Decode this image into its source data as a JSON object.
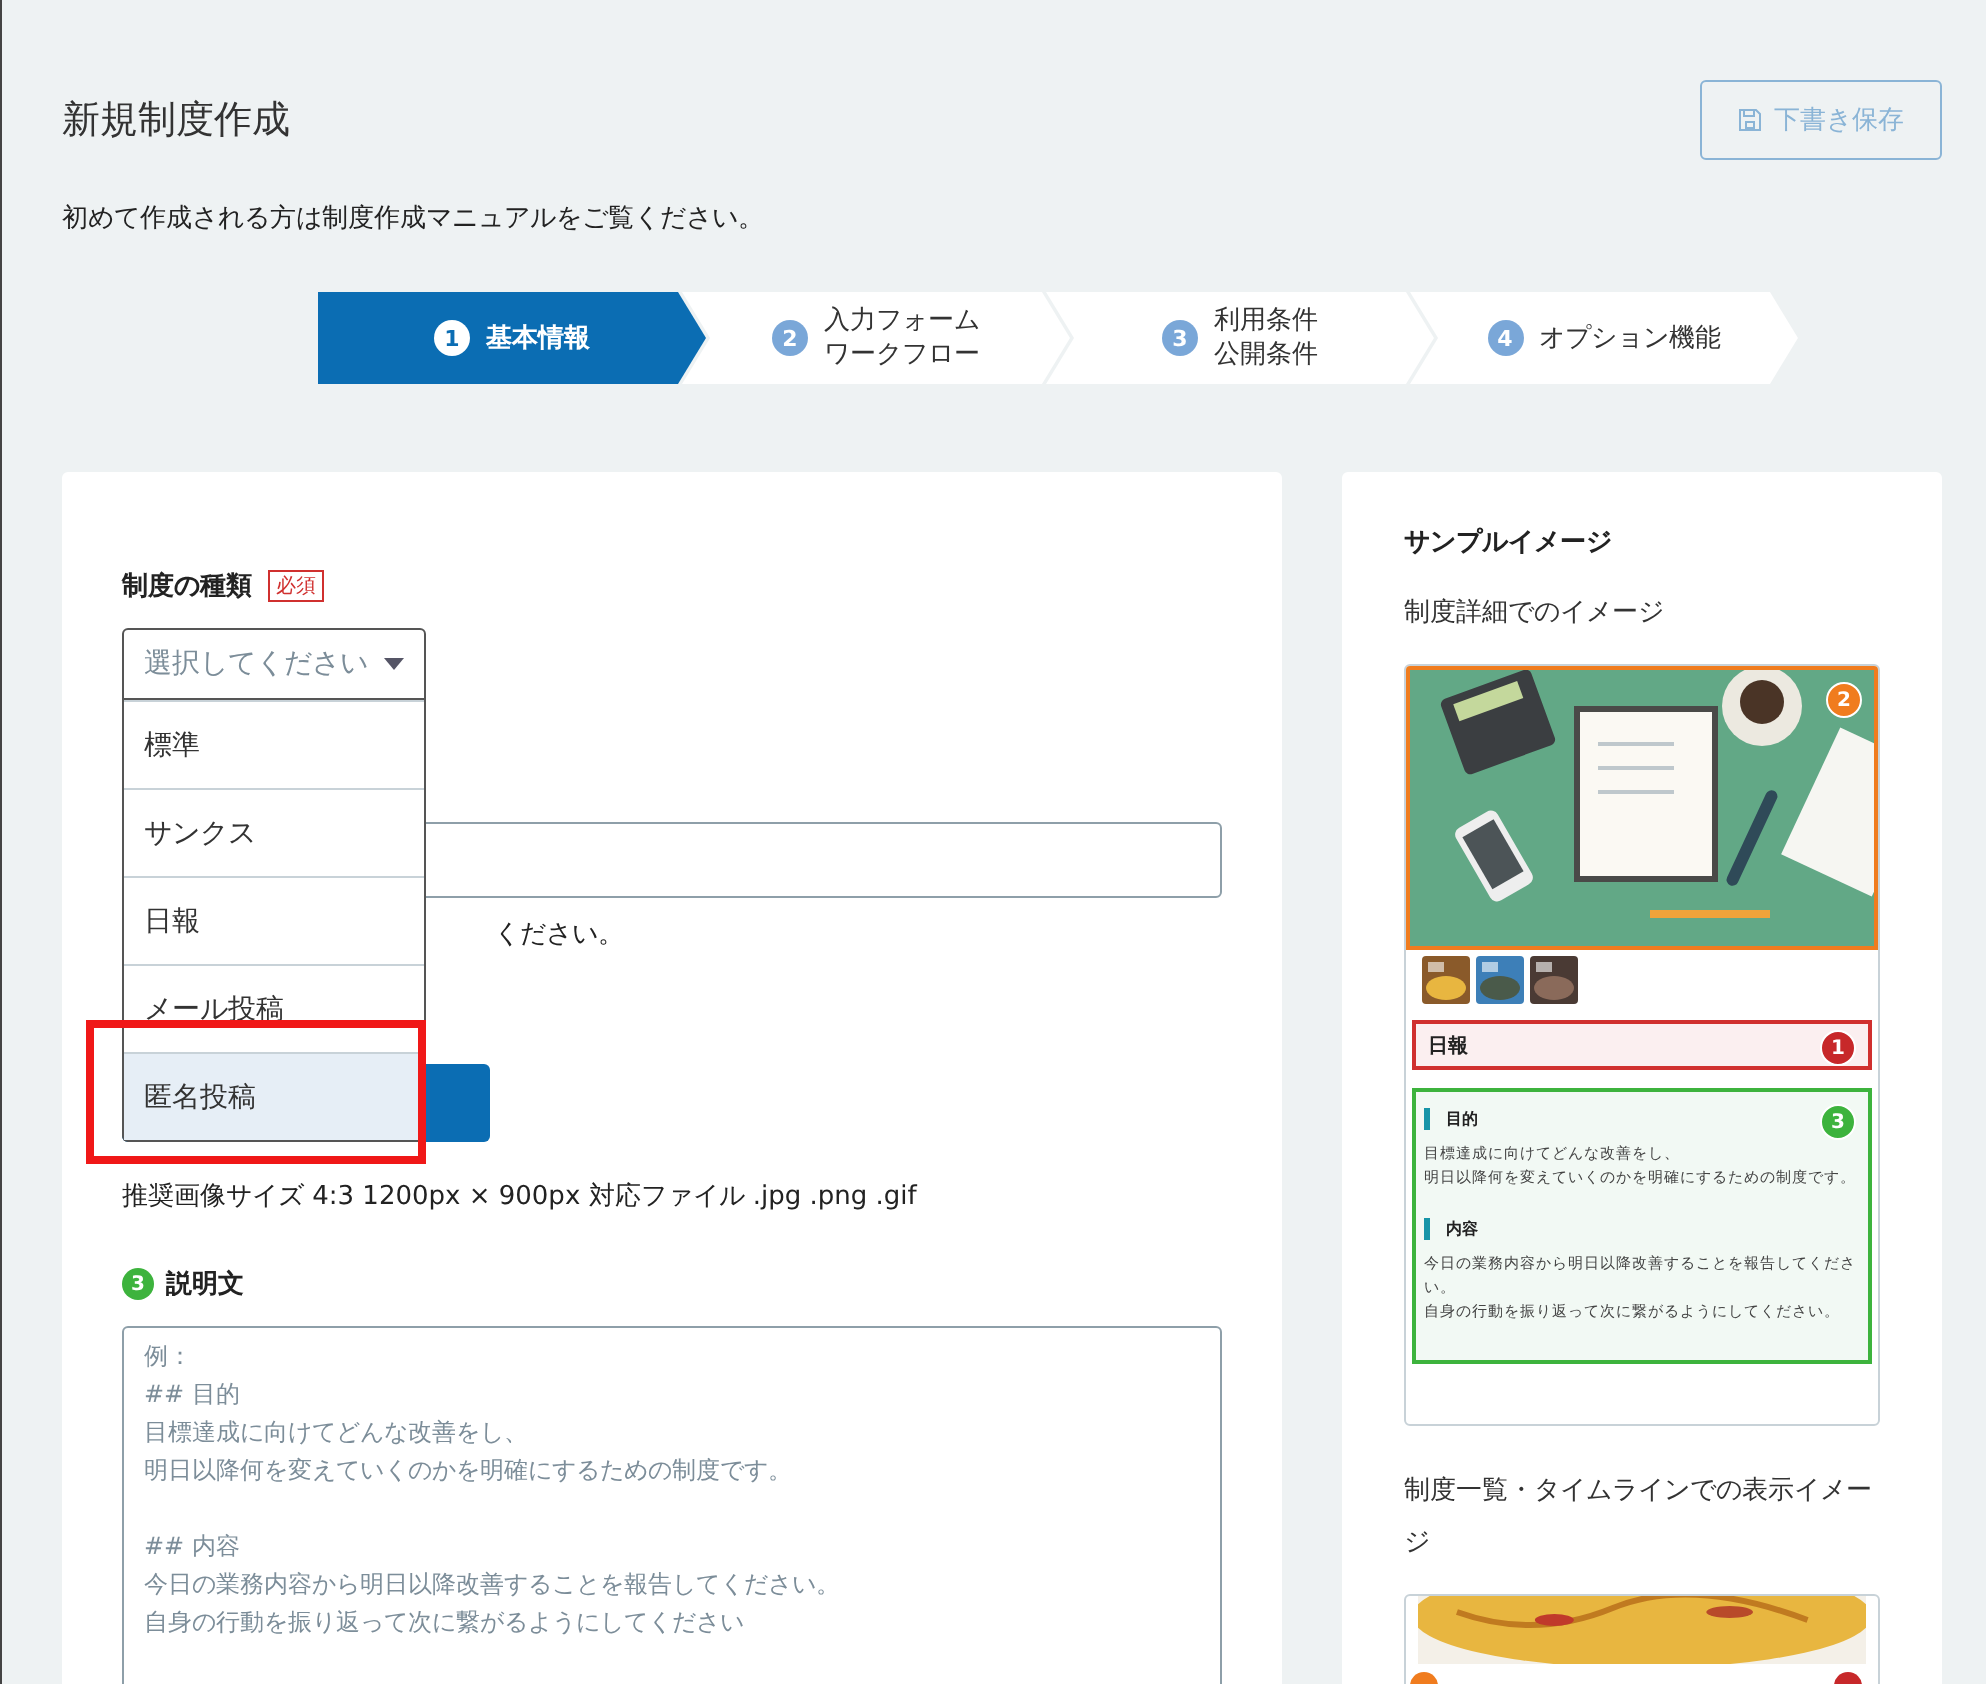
{
  "header": {
    "title": "新規制度作成",
    "save_button": "下書き保存",
    "intro": "初めて作成される方は制度作成マニュアルをご覧ください。"
  },
  "steps": [
    {
      "number": "1",
      "lines": [
        "基本情報"
      ],
      "selected": true
    },
    {
      "number": "2",
      "lines": [
        "入力フォーム",
        "ワークフロー"
      ],
      "selected": false
    },
    {
      "number": "3",
      "lines": [
        "利用条件",
        "公開条件"
      ],
      "selected": false
    },
    {
      "number": "4",
      "lines": [
        "オプション機能"
      ],
      "selected": false
    }
  ],
  "form": {
    "type_label": "制度の種類",
    "required_badge": "必須",
    "select": {
      "placeholder": "選択してください",
      "expanded": true,
      "options": [
        {
          "label": "標準",
          "selected": false
        },
        {
          "label": "サンクス",
          "selected": false
        },
        {
          "label": "日報",
          "selected": false
        },
        {
          "label": "メール投稿",
          "selected": false
        },
        {
          "label": "匿名投稿",
          "selected": true
        }
      ]
    },
    "name_hint": "ください。",
    "image_hint": "推奨画像サイズ 4:3 1200px × 900px 対応ファイル .jpg .png .gif",
    "description": {
      "number": "3",
      "label": "説明文",
      "placeholder_paragraphs": [
        [
          "例：",
          "## 目的",
          "目標達成に向けてどんな改善をし、",
          "明日以降何を変えていくのかを明確にするための制度です。"
        ],
        [
          "## 内容",
          "今日の業務内容から明日以降改善することを報告してください。",
          "自身の行動を振り返って次に繋がるようにしてください"
        ]
      ]
    }
  },
  "sample": {
    "title": "サンプルイメージ",
    "detail_heading": "制度詳細でのイメージ",
    "detail": {
      "image_badge": "2",
      "name": "日報",
      "name_badge": "1",
      "body_badge": "3",
      "sections": [
        {
          "heading": "目的",
          "lines": [
            "目標達成に向けてどんな改善をし、",
            "明日以降何を変えていくのかを明確にするための制度です。"
          ]
        },
        {
          "heading": "内容",
          "lines": [
            "今日の業務内容から明日以降改善することを報告してください。",
            "自身の行動を振り返って次に繋がるようにしてください。"
          ]
        }
      ]
    },
    "list_heading": "制度一覧・タイムラインでの表示イメージ"
  }
}
